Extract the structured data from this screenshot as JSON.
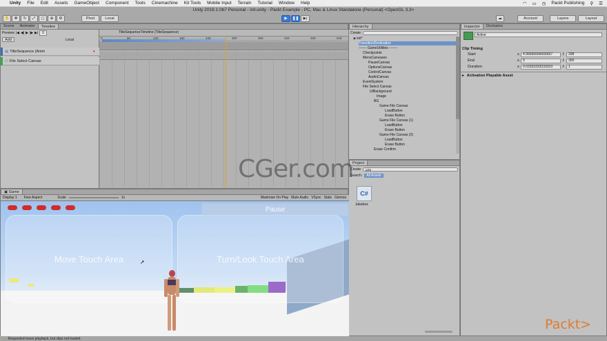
{
  "menubar": {
    "app": "Unity",
    "items": [
      "File",
      "Edit",
      "Assets",
      "GameObject",
      "Component",
      "Tools",
      "Cinemachine",
      "Kit Tools",
      "Mobile Input",
      "Terrain",
      "Tutorial",
      "Window",
      "Help"
    ],
    "right_text": "Packt Publishing"
  },
  "window_title": "Unity 2019.1.0b7 Personal - init.unity - Packt Example - PC, Mac & Linux Standalone (Personal) <OpenGL 3.3>",
  "toolbar": {
    "pivot": "Pivot",
    "local": "Local",
    "account": "Account",
    "layers": "Layers",
    "layout": "Layout"
  },
  "timeline": {
    "tabs": [
      "Scene",
      "Animator",
      "Timeline"
    ],
    "preview_label": "Preview",
    "add_label": "Add",
    "local_label": "Local",
    "asset_name": "TitleSequenceTimeline (TitleSequence)",
    "time_value": "0",
    "tracks": [
      {
        "label": "TitleSequence (Anim",
        "color": "#3a6fb0"
      },
      {
        "label": "File Select Canvas",
        "color": "#3da84a"
      }
    ],
    "ruler": [
      "0",
      "60",
      "120",
      "180",
      "240",
      "300",
      "360",
      "420",
      "480",
      "540"
    ]
  },
  "hierarchy": {
    "tab": "Hierarchy",
    "create": "Create",
    "scene": "init*",
    "items": [
      {
        "label": "TransitionDestination",
        "indent": 1
      },
      {
        "label": "------- GameUtilities -------",
        "indent": 1
      },
      {
        "label": "Checkpoints",
        "indent": 1
      },
      {
        "label": "MenuCanvases",
        "indent": 1
      },
      {
        "label": "PauseCanvas",
        "indent": 2
      },
      {
        "label": "OptionsCanvas",
        "indent": 2
      },
      {
        "label": "ControlCanvas",
        "indent": 2
      },
      {
        "label": "AudioCanvas",
        "indent": 2
      },
      {
        "label": "EventSystem",
        "indent": 1
      },
      {
        "label": "File Select Canvas",
        "indent": 1
      },
      {
        "label": "UIBackground",
        "indent": 2
      },
      {
        "label": "Image",
        "indent": 3
      },
      {
        "label": "BG",
        "indent": 2
      },
      {
        "label": "Game File Canvas",
        "indent": 3
      },
      {
        "label": "LoadButton",
        "indent": 4
      },
      {
        "label": "Erase Button",
        "indent": 4
      },
      {
        "label": "Game File Canvas (1)",
        "indent": 3
      },
      {
        "label": "LoadButton",
        "indent": 4
      },
      {
        "label": "Erase Button",
        "indent": 4
      },
      {
        "label": "Game File Canvas (2)",
        "indent": 3
      },
      {
        "label": "LoadButton",
        "indent": 4
      },
      {
        "label": "Erase Button",
        "indent": 4
      },
      {
        "label": "Erase Confirm",
        "indent": 2
      }
    ]
  },
  "project": {
    "tab": "Project",
    "create": "Create",
    "search_value": "juke",
    "search_scope": "Search:",
    "scope_assets": "All Assets",
    "asset_name": "Jukebox",
    "asset_icon": "C#"
  },
  "inspector": {
    "tabs": [
      "Inspector",
      "Occlusion"
    ],
    "object_name": "Active",
    "section": "Clip Timing",
    "rows": [
      {
        "label": "Start",
        "s_unit": "s",
        "s_value": "4.96666666666667",
        "f_unit": "f",
        "f_value": "298"
      },
      {
        "label": "End",
        "s_unit": "s",
        "s_value": "5",
        "f_unit": "f",
        "f_value": "300"
      },
      {
        "label": "Duration",
        "s_unit": "s",
        "s_value": "0.03333333333333",
        "f_unit": "f",
        "f_value": "1"
      }
    ],
    "asset_section": "Activation Playable Asset"
  },
  "game": {
    "tab": "Game",
    "display": "Display 1",
    "aspect": "Free Aspect",
    "scale_label": "Scale",
    "scale_value": "1x",
    "options": [
      "Maximize On Play",
      "Mute Audio",
      "VSync",
      "Stats",
      "Gizmos"
    ],
    "pause_label": "Pause",
    "move_area": "Move Touch Area",
    "look_area": "Turn/Look Touch Area",
    "heart_color": "#d42a2a"
  },
  "status_text": "Requested move playback, but clips not loaded.",
  "watermark": "CGer.com",
  "brand": "Packt>"
}
